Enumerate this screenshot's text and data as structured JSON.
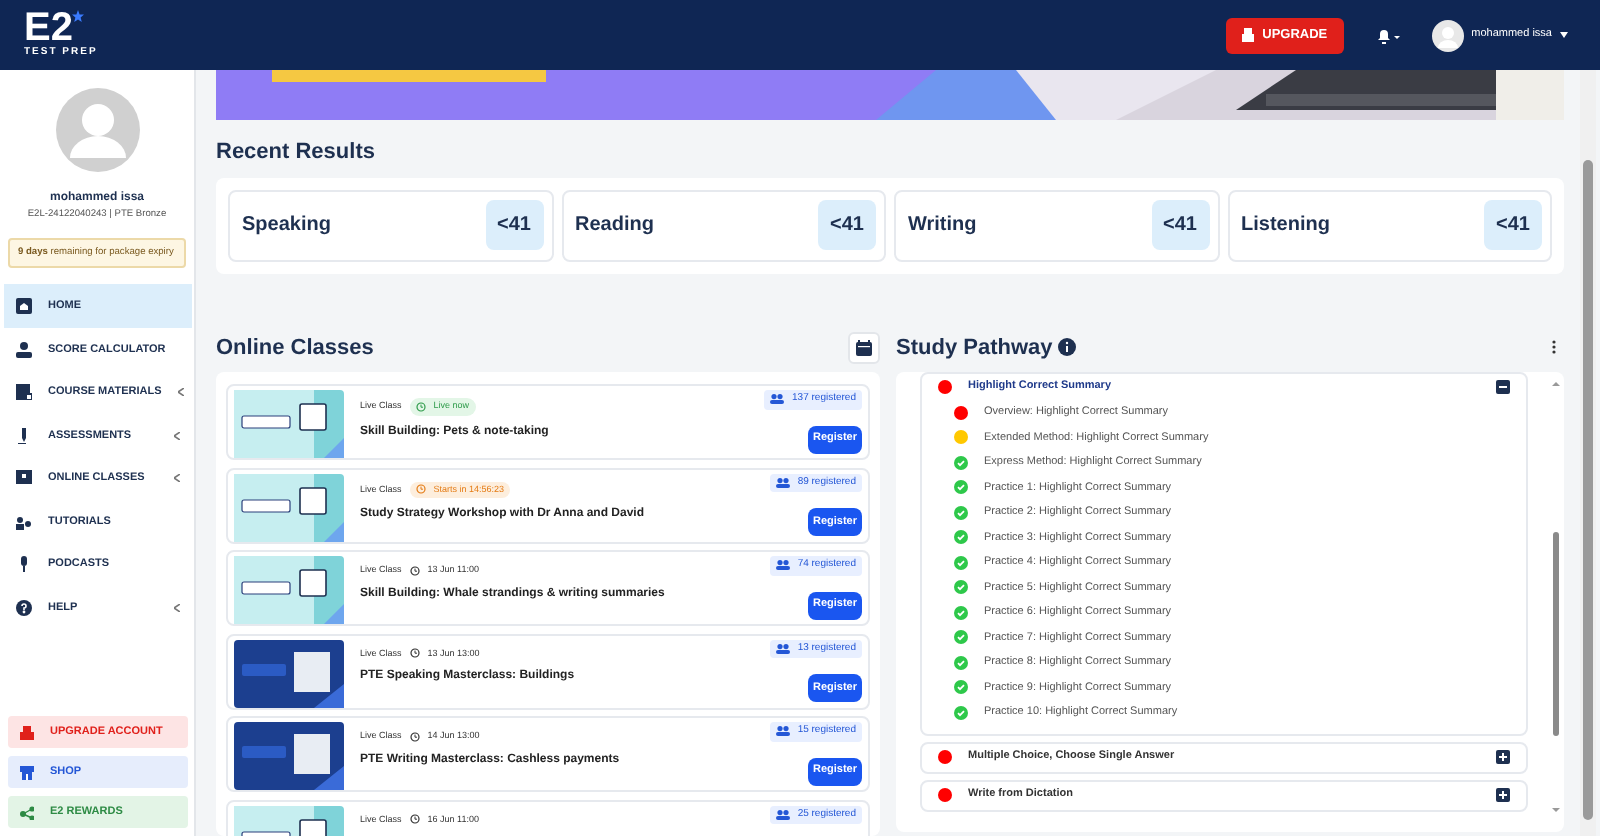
{
  "header": {
    "logo": "E2",
    "logo_sub": "TEST PREP",
    "upgrade_button": "UPGRADE",
    "user_name": "mohammed issa"
  },
  "profile": {
    "name": "mohammed issa",
    "account": "E2L-24122040243 | PTE Bronze",
    "expiry": "**9 days** remaining for package expiry"
  },
  "sidebar": {
    "items": [
      {
        "label": "HOME",
        "selected": true,
        "expandable": false
      },
      {
        "label": "SCORE CALCULATOR",
        "selected": false,
        "expandable": false
      },
      {
        "label": "COURSE MATERIALS",
        "selected": false,
        "expandable": true
      },
      {
        "label": "ASSESSMENTS",
        "selected": false,
        "expandable": true
      },
      {
        "label": "ONLINE CLASSES",
        "selected": false,
        "expandable": true
      },
      {
        "label": "TUTORIALS",
        "selected": false,
        "expandable": false
      },
      {
        "label": "PODCASTS",
        "selected": false,
        "expandable": false
      },
      {
        "label": "HELP",
        "selected": false,
        "expandable": true
      }
    ],
    "footer_items": [
      {
        "label": "UPGRADE ACCOUNT",
        "kind": "upgrade"
      },
      {
        "label": "SHOP",
        "kind": "shop"
      },
      {
        "label": "E2 REWARDS",
        "kind": "rewards"
      }
    ]
  },
  "recent_results": {
    "title": "Recent Results",
    "items": [
      {
        "skill": "Speaking",
        "score": "<41"
      },
      {
        "skill": "Reading",
        "score": "<41"
      },
      {
        "skill": "Writing",
        "score": "<41"
      },
      {
        "skill": "Listening",
        "score": "<41"
      }
    ]
  },
  "online_classes": {
    "title": "Online Classes",
    "classes": [
      {
        "type": "Live Class",
        "status": {
          "kind": "live",
          "text": "Live now"
        },
        "title": "Skill Building: Pets & note-taking",
        "registered": "137 registered",
        "button": "Register"
      },
      {
        "type": "Live Class",
        "status": {
          "kind": "countdown",
          "text": "Starts in 14:56:23"
        },
        "title": "Study Strategy Workshop with Dr Anna and David",
        "registered": "89 registered",
        "button": "Register"
      },
      {
        "type": "Live Class",
        "status": {
          "kind": "scheduled",
          "text": "13 Jun 11:00"
        },
        "title": "Skill Building: Whale strandings & writing summaries",
        "registered": "74 registered",
        "button": "Register"
      },
      {
        "type": "Live Class",
        "status": {
          "kind": "scheduled",
          "text": "13 Jun 13:00"
        },
        "title": "PTE Speaking Masterclass: Buildings",
        "registered": "13 registered",
        "button": "Register"
      },
      {
        "type": "Live Class",
        "status": {
          "kind": "scheduled",
          "text": "14 Jun 13:00"
        },
        "title": "PTE Writing Masterclass: Cashless payments",
        "registered": "15 registered",
        "button": "Register"
      },
      {
        "type": "Live Class",
        "status": {
          "kind": "scheduled",
          "text": "16 Jun 11:00"
        },
        "registered": "25 registered"
      }
    ]
  },
  "study_pathway": {
    "title": "Study Pathway",
    "groups": [
      {
        "title": "Highlight Correct Summary",
        "color": "#ff0000",
        "expanded": true,
        "children": [
          {
            "title": "Overview: Highlight Correct Summary",
            "color": "#ff0000",
            "checked": false
          },
          {
            "title": "Extended Method: Highlight Correct Summary",
            "color": "#ffc800",
            "checked": false
          },
          {
            "title": "Express Method: Highlight Correct Summary",
            "color": "#2ec84a",
            "checked": true
          },
          {
            "title": "Practice 1: Highlight Correct Summary",
            "color": "#2ec84a",
            "checked": true
          },
          {
            "title": "Practice 2: Highlight Correct Summary",
            "color": "#2ec84a",
            "checked": true
          },
          {
            "title": "Practice 3: Highlight Correct Summary",
            "color": "#2ec84a",
            "checked": true
          },
          {
            "title": "Practice 4: Highlight Correct Summary",
            "color": "#2ec84a",
            "checked": true
          },
          {
            "title": "Practice 5: Highlight Correct Summary",
            "color": "#2ec84a",
            "checked": true
          },
          {
            "title": "Practice 6: Highlight Correct Summary",
            "color": "#2ec84a",
            "checked": true
          },
          {
            "title": "Practice 7: Highlight Correct Summary",
            "color": "#2ec84a",
            "checked": true
          },
          {
            "title": "Practice 8: Highlight Correct Summary",
            "color": "#2ec84a",
            "checked": true
          },
          {
            "title": "Practice 9: Highlight Correct Summary",
            "color": "#2ec84a",
            "checked": true
          },
          {
            "title": "Practice 10: Highlight Correct Summary",
            "color": "#2ec84a",
            "checked": true
          }
        ]
      },
      {
        "title": "Multiple Choice, Choose Single Answer",
        "color": "#ff0000",
        "expanded": false
      },
      {
        "title": "Write from Dictation",
        "color": "#ff0000",
        "expanded": false
      }
    ]
  }
}
